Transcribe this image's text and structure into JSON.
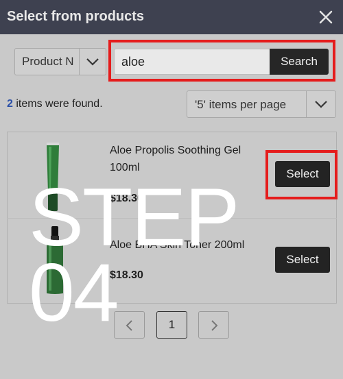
{
  "dialog": {
    "title": "Select from products",
    "close_icon": "close-icon"
  },
  "search": {
    "category_label": "Product N",
    "query": "aloe",
    "button_label": "Search",
    "highlight_color": "#e51c1c"
  },
  "results": {
    "count": "2",
    "count_suffix": " items were found.",
    "per_page_label": "'5' items per page"
  },
  "products": [
    {
      "name": "Aloe Propolis Soothing Gel 100ml",
      "price": "$18.30",
      "select_label": "Select"
    },
    {
      "name": "Aloe BHA Skin Toner 200ml",
      "price": "$18.30",
      "select_label": "Select"
    }
  ],
  "pagination": {
    "current_page": "1"
  },
  "overlay": {
    "line1": "STEP",
    "line2": "04"
  },
  "colors": {
    "title_bar": "#3e4150",
    "button": "#232323",
    "count_accent": "#2b50a8"
  }
}
